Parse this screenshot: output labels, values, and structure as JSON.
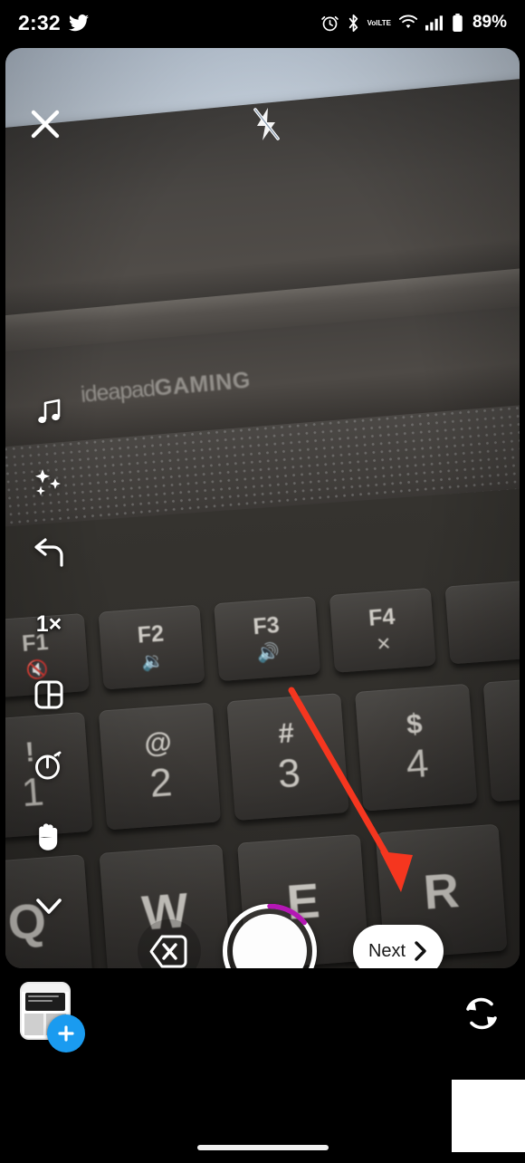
{
  "status_bar": {
    "time": "2:32",
    "app_notification_icon": "twitter-bird-icon",
    "right_icons": [
      "alarm-clock-icon",
      "bluetooth-icon",
      "volte-icon",
      "wifi-icon",
      "cellular-signal-icon",
      "battery-icon"
    ],
    "volte_line1": "VoI",
    "volte_line2": "LTE",
    "battery_percent": "89%"
  },
  "camera": {
    "close_label": "close-icon",
    "flash_label": "flash-off-icon",
    "zoom_level": "1×",
    "tools": [
      {
        "name": "music",
        "icon": "music-note-icon"
      },
      {
        "name": "effects",
        "icon": "sparkles-icon"
      },
      {
        "name": "undo",
        "icon": "undo-arrow-icon"
      },
      {
        "name": "zoom",
        "icon": "zoom-level-text"
      },
      {
        "name": "layout",
        "icon": "layout-grid-icon"
      },
      {
        "name": "timer",
        "icon": "timer-icon"
      },
      {
        "name": "hands-free",
        "icon": "hand-icon"
      },
      {
        "name": "collapse",
        "icon": "chevron-down-icon"
      }
    ],
    "delete_clip_label": "delete-clip-icon",
    "next_label": "Next",
    "next_chevron": "›",
    "capture_progress_percent": 14,
    "progress_color": "#b417b4",
    "gallery_label": "gallery-thumbnail",
    "gallery_add_badge": "+",
    "gallery_badge_color": "#1a9bf0",
    "flip_label": "camera-flip-icon"
  },
  "scene": {
    "laptop_brand_light": "ideapad",
    "laptop_brand_bold": "GAMING",
    "function_keys": [
      {
        "label": "F1",
        "sub": "🔇"
      },
      {
        "label": "F2",
        "sub": "🔉"
      },
      {
        "label": "F3",
        "sub": "🔊"
      },
      {
        "label": "F4",
        "sub": "✕"
      }
    ],
    "number_keys": [
      {
        "label": "!",
        "sub": "1"
      },
      {
        "label": "@",
        "sub": "2"
      },
      {
        "label": "#",
        "sub": "3"
      },
      {
        "label": "$",
        "sub": "4"
      }
    ],
    "letter_keys": [
      {
        "label": "Q"
      },
      {
        "label": "W"
      },
      {
        "label": "E"
      },
      {
        "label": "R"
      }
    ]
  },
  "annotation": {
    "arrow_color": "#f5361f",
    "target": "next-button"
  }
}
